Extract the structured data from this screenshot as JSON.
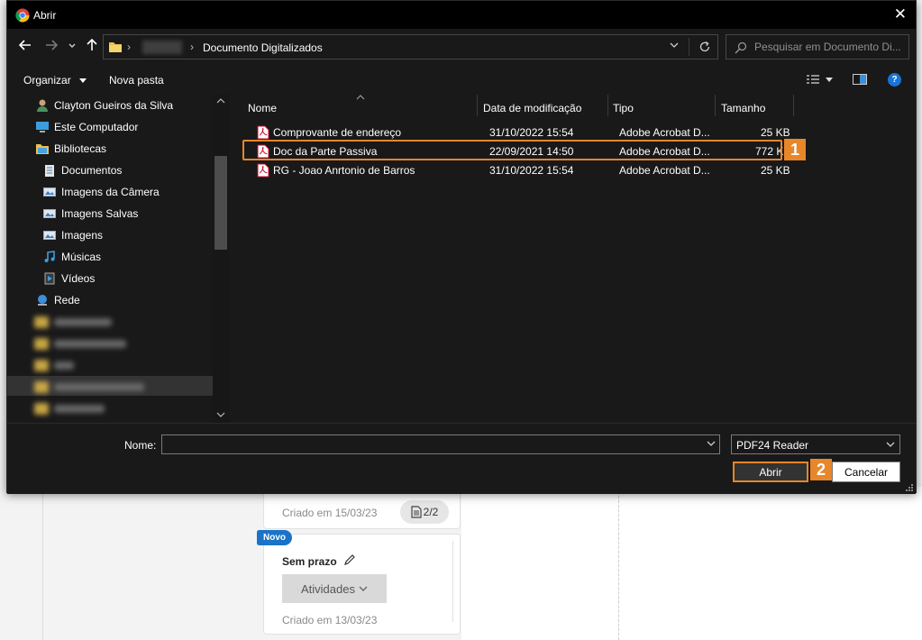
{
  "dialog": {
    "title": "Abrir",
    "breadcrumb": {
      "hidden_segment": "•••••",
      "current": "Documento Digitalizados"
    },
    "search_placeholder": "Pesquisar em Documento Di...",
    "toolbar": {
      "organize": "Organizar",
      "new_folder": "Nova pasta"
    },
    "nav": {
      "items": [
        {
          "label": "Clayton Gueiros da Silva",
          "icon": "user-icon"
        },
        {
          "label": "Este Computador",
          "icon": "computer-icon"
        },
        {
          "label": "Bibliotecas",
          "icon": "libraries-icon"
        },
        {
          "label": "Documentos",
          "icon": "documents-icon"
        },
        {
          "label": "Imagens da Câmera",
          "icon": "pictures-icon"
        },
        {
          "label": "Imagens Salvas",
          "icon": "pictures-icon"
        },
        {
          "label": "Imagens",
          "icon": "pictures-icon"
        },
        {
          "label": "Músicas",
          "icon": "music-icon"
        },
        {
          "label": "Vídeos",
          "icon": "videos-icon"
        },
        {
          "label": "Rede",
          "icon": "network-icon"
        }
      ]
    },
    "columns": {
      "name": "Nome",
      "modified": "Data de modificação",
      "type": "Tipo",
      "size": "Tamanho"
    },
    "files": [
      {
        "name": "Comprovante de endereço",
        "modified": "31/10/2022 15:54",
        "type": "Adobe Acrobat D...",
        "size": "25 KB"
      },
      {
        "name": "Doc da Parte Passiva",
        "modified": "22/09/2021 14:50",
        "type": "Adobe Acrobat D...",
        "size": "772 KB"
      },
      {
        "name": "RG - Joao Anrtonio de Barros",
        "modified": "31/10/2022 15:54",
        "type": "Adobe Acrobat D...",
        "size": "25 KB"
      }
    ],
    "filename_label": "Nome:",
    "filename_value": "",
    "filter": "PDF24 Reader",
    "open_button": "Abrir",
    "cancel_button": "Cancelar"
  },
  "annotations": {
    "step1": "1",
    "step2": "2",
    "color": "#e8862a"
  },
  "background": {
    "card1": {
      "created": "Criado em 15/03/23",
      "pages": "2/2"
    },
    "card2": {
      "badge": "Novo",
      "deadline": "Sem prazo",
      "activities": "Atividades",
      "created": "Criado em 13/03/23"
    }
  },
  "colors": {
    "dialog_bg": "#191919",
    "titlebar_bg": "#000000",
    "accent": "#1a73d9"
  }
}
